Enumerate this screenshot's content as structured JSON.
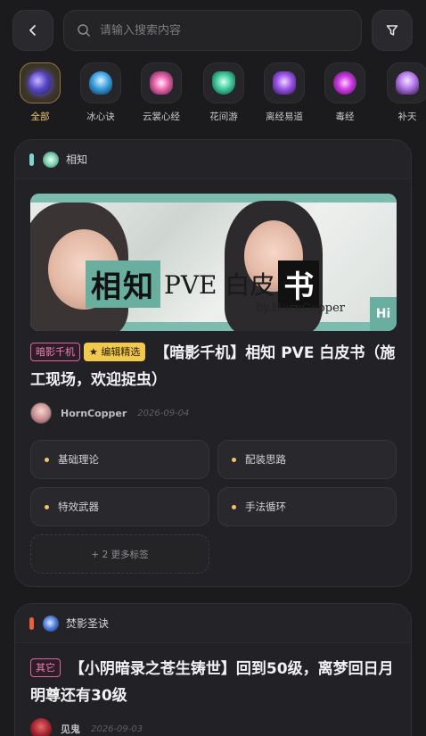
{
  "search": {
    "placeholder": "请输入搜索内容"
  },
  "categories": [
    {
      "label": "全部",
      "icon": "all-orb-icon",
      "active": true
    },
    {
      "label": "冰心诀",
      "icon": "bingxin-icon"
    },
    {
      "label": "云裳心经",
      "icon": "yunshang-icon"
    },
    {
      "label": "花间游",
      "icon": "huajian-icon"
    },
    {
      "label": "离经易道",
      "icon": "lijing-icon"
    },
    {
      "label": "毒经",
      "icon": "dujing-icon"
    },
    {
      "label": "补天",
      "icon": "butian-icon"
    }
  ],
  "posts": [
    {
      "section": "相知",
      "section_color": "#7fd3d0",
      "banner": {
        "main": "相知",
        "mid": "PVE 白皮",
        "end": "书",
        "by": "by.HornCopper",
        "corner": "Hi"
      },
      "tags": [
        "暗影千机",
        "★ 编辑精选"
      ],
      "title": "【暗影千机】相知 PVE 白皮书（施工现场，欢迎捉虫）",
      "author": "HornCopper",
      "date": "2026-09-04",
      "chips": [
        "基础理论",
        "配装思路",
        "特效武器",
        "手法循环"
      ],
      "more": "+ 2 更多标签"
    },
    {
      "section": "焚影圣诀",
      "section_color": "#e8603c",
      "tags": [
        "其它"
      ],
      "title": "【小阴暗录之苍生铸世】回到50级，离梦回日月明尊还有30级",
      "author": "见鬼",
      "date": "2026-09-03"
    }
  ]
}
